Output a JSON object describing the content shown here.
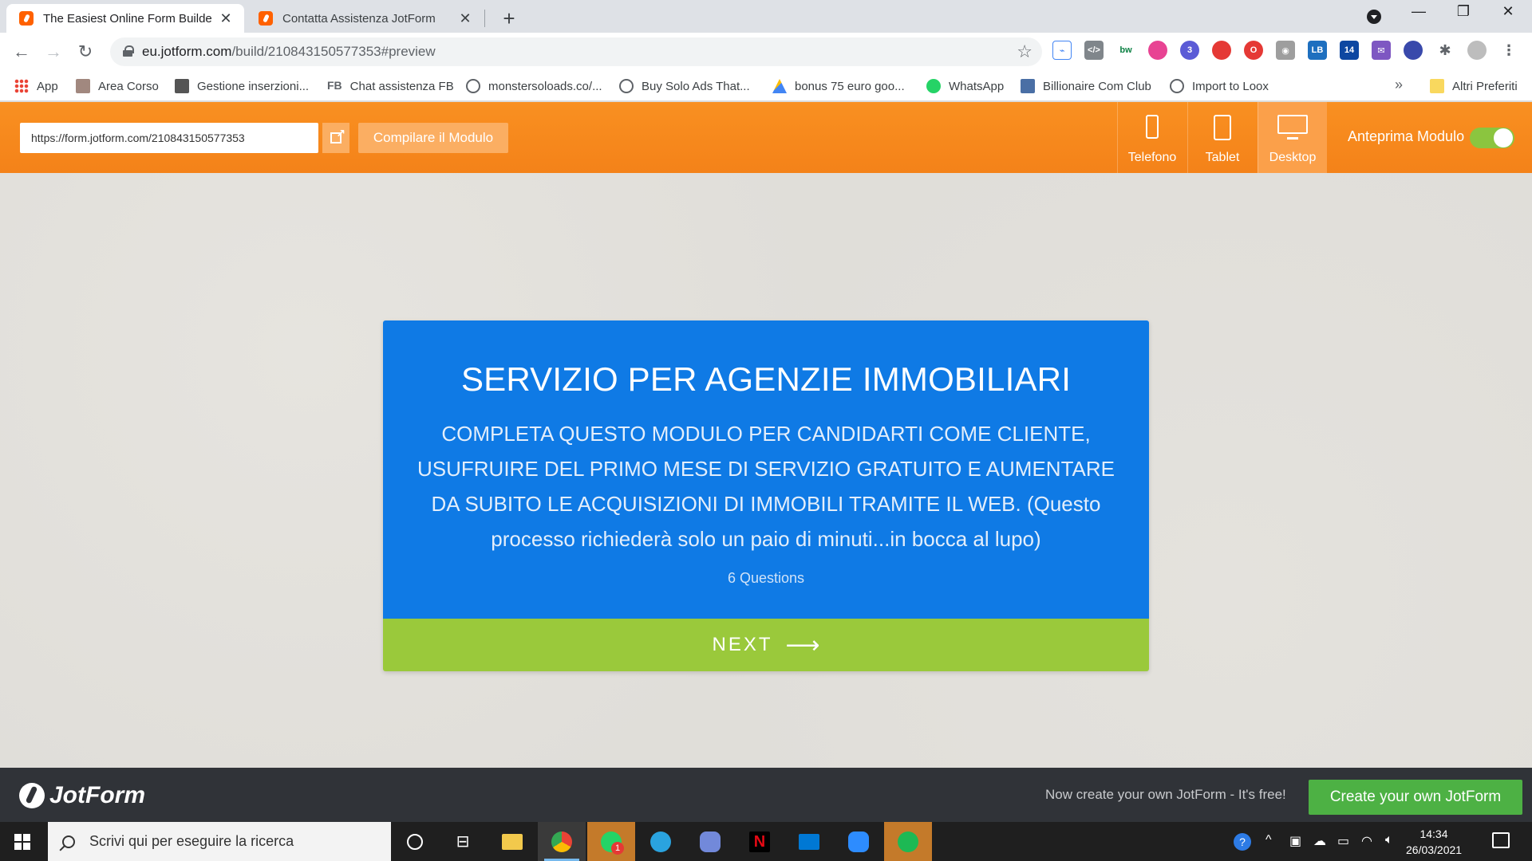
{
  "browser": {
    "tabs": [
      {
        "title": "The Easiest Online Form Builder",
        "active": true
      },
      {
        "title": "Contatta Assistenza JotForm",
        "active": false
      }
    ],
    "address": {
      "host": "eu.jotform.com",
      "path": "/build/210843150577353#preview"
    },
    "bookmarks": [
      {
        "label": "App",
        "icon": "apps-grid-icon"
      },
      {
        "label": "Area Corso",
        "icon": "page-icon"
      },
      {
        "label": "Gestione inserzioni...",
        "icon": "ads-manager-icon"
      },
      {
        "label": "Chat assistenza FB",
        "icon": "fb-text-icon",
        "prefix": "FB"
      },
      {
        "label": "monstersoloads.co/...",
        "icon": "globe-icon"
      },
      {
        "label": "Buy Solo Ads That...",
        "icon": "globe-icon"
      },
      {
        "label": "bonus 75 euro goo...",
        "icon": "google-ads-icon"
      },
      {
        "label": "WhatsApp",
        "icon": "whatsapp-icon"
      },
      {
        "label": "Billionaire Com Club",
        "icon": "billionaire-icon"
      },
      {
        "label": "Import to Loox",
        "icon": "globe-icon"
      }
    ],
    "other_bookmarks": "Altri Preferiti",
    "more": "»"
  },
  "jotform_header": {
    "form_url": "https://form.jotform.com/210843150577353",
    "fill_button": "Compilare il Modulo",
    "devices": [
      {
        "label": "Telefono",
        "icon": "phone-icon"
      },
      {
        "label": "Tablet",
        "icon": "tablet-icon"
      },
      {
        "label": "Desktop",
        "icon": "desktop-icon",
        "active": true
      }
    ],
    "preview_label": "Anteprima Modulo",
    "preview_on": true
  },
  "form": {
    "title": "SERVIZIO PER AGENZIE IMMOBILIARI",
    "description": "COMPLETA QUESTO MODULO PER CANDIDARTI COME CLIENTE, USUFRUIRE DEL PRIMO MESE DI SERVIZIO GRATUITO E AUMENTARE DA SUBITO LE ACQUISIZIONI DI IMMOBILI TRAMITE IL WEB. (Questo processo richiederà solo un paio di minuti...in bocca al lupo)",
    "question_count": "6 Questions",
    "next_label": "NEXT",
    "card_color": "#0f7ae5",
    "next_color": "#9ac93b"
  },
  "jotform_footer": {
    "brand": "JotForm",
    "cta_text": "Now create your own JotForm - It's free!",
    "cta_button": "Create your own JotForm"
  },
  "taskbar": {
    "search_placeholder": "Scrivi qui per eseguire la ricerca",
    "time": "14:34",
    "date": "26/03/2021",
    "whatsapp_badge": "1"
  }
}
